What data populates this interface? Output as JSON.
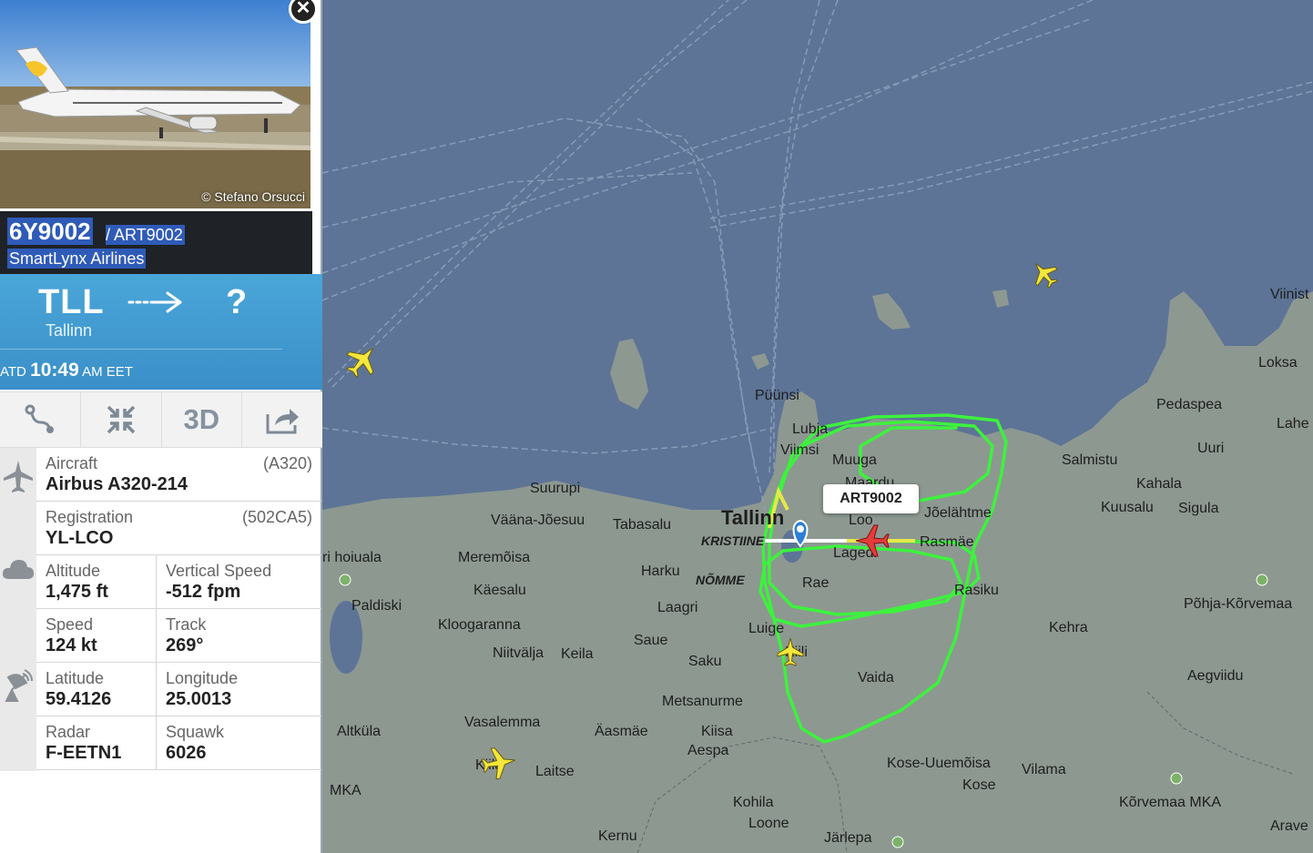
{
  "map": {
    "places": [
      "Püünsi",
      "Lubja",
      "Viimsi",
      "Muuga",
      "Maardu",
      "Loo",
      "Jõelähtme",
      "Rasmäe",
      "Lagedi",
      "Tallinn",
      "Kristiine",
      "Nõmme",
      "Rae",
      "Suurupi",
      "Vääna-Jõesuu",
      "Tabasalu",
      "Harku",
      "Laagri",
      "Meremõisa",
      "Käesalu",
      "Paldiski",
      "Kloogaranna",
      "Niitvälja",
      "Keila",
      "Saue",
      "Saku",
      "Luige",
      "Vaida",
      "Metsanurme",
      "Vasalemma",
      "Äasmäe",
      "Kiisa",
      "Aespa",
      "Altküla",
      "Laitse",
      "Kose-Uuemõisa",
      "Kose",
      "Vilama",
      "Kohila",
      "Loone",
      "Järlepa",
      "Kernu",
      "Salmistu",
      "Kahala",
      "Kuusalu",
      "Sigula",
      "Pedaspea",
      "Uuri",
      "Loksa",
      "Kehra",
      "Aegviidu",
      "Põhja-Kõrvemaa",
      "Kõrvemaa MKA",
      "Viinist",
      "Lahe",
      "Arave",
      "ri hoiuala",
      "MKA",
      "Rasiku",
      "Kiila"
    ],
    "aircraft_callout": "ART9002"
  },
  "panel": {
    "photo_credit": "© Stefano Orsucci",
    "close_icon": "close-icon",
    "callsign": "6Y9002",
    "callsign_alt": " / ART9002",
    "airline": "SmartLynx Airlines",
    "route": {
      "from_code": "TLL",
      "from_city": "Tallinn",
      "to_code": "?",
      "atd_prefix": "ATD",
      "atd_time": "10:49",
      "atd_suffix": "AM EET"
    },
    "toolbar": {
      "route_icon": "route-icon",
      "collapse_icon": "collapse-icon",
      "three_d": "3D",
      "share_icon": "share-icon"
    },
    "info": {
      "aircraft_label": "Aircraft",
      "aircraft_value": "Airbus A320-214",
      "aircraft_code": "(A320)",
      "registration_label": "Registration",
      "registration_value": "YL-LCO",
      "registration_code": "(502CA5)",
      "altitude_label": "Altitude",
      "altitude_value": "1,475 ft",
      "vspeed_label": "Vertical Speed",
      "vspeed_value": "-512 fpm",
      "speed_label": "Speed",
      "speed_value": "124 kt",
      "track_label": "Track",
      "track_value": "269°",
      "lat_label": "Latitude",
      "lat_value": "59.4126",
      "lon_label": "Longitude",
      "lon_value": "25.0013",
      "radar_label": "Radar",
      "radar_value": "F-EETN1",
      "squawk_label": "Squawk",
      "squawk_value": "6026"
    }
  },
  "colors": {
    "sea": "#5d7496",
    "land": "#8d9891",
    "track": "#3df23d",
    "panel_blue": "#3a8fc8",
    "highlight": "#2f5bb8"
  }
}
